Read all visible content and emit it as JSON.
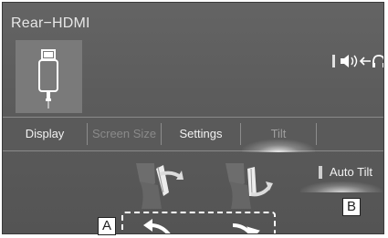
{
  "header": {
    "title": "Rear−HDMI"
  },
  "source": {
    "icon": "hdmi-connector-icon"
  },
  "audio_output": {
    "icon": "speaker-to-headphones-icon",
    "text": "🕪←∩"
  },
  "tabs": [
    {
      "label": "Display",
      "state": "normal"
    },
    {
      "label": "Screen Size",
      "state": "disabled"
    },
    {
      "label": "Settings",
      "state": "normal"
    },
    {
      "label": "Tilt",
      "state": "selected"
    }
  ],
  "tilt": {
    "seat_left_icon": "seat-tilt-back-icon",
    "seat_right_icon": "seat-tilt-forward-icon",
    "auto_tilt_label": "Auto Tilt",
    "rotate_left_icon": "rotate-left-arrow-icon",
    "rotate_right_icon": "rotate-right-arrow-icon"
  },
  "callouts": {
    "a": "A",
    "b": "B"
  },
  "colors": {
    "screen_bg": "#5c5c5c",
    "text": "#f2f2f2",
    "disabled": "#8a8a8a",
    "tile": "#7a7a7a"
  }
}
